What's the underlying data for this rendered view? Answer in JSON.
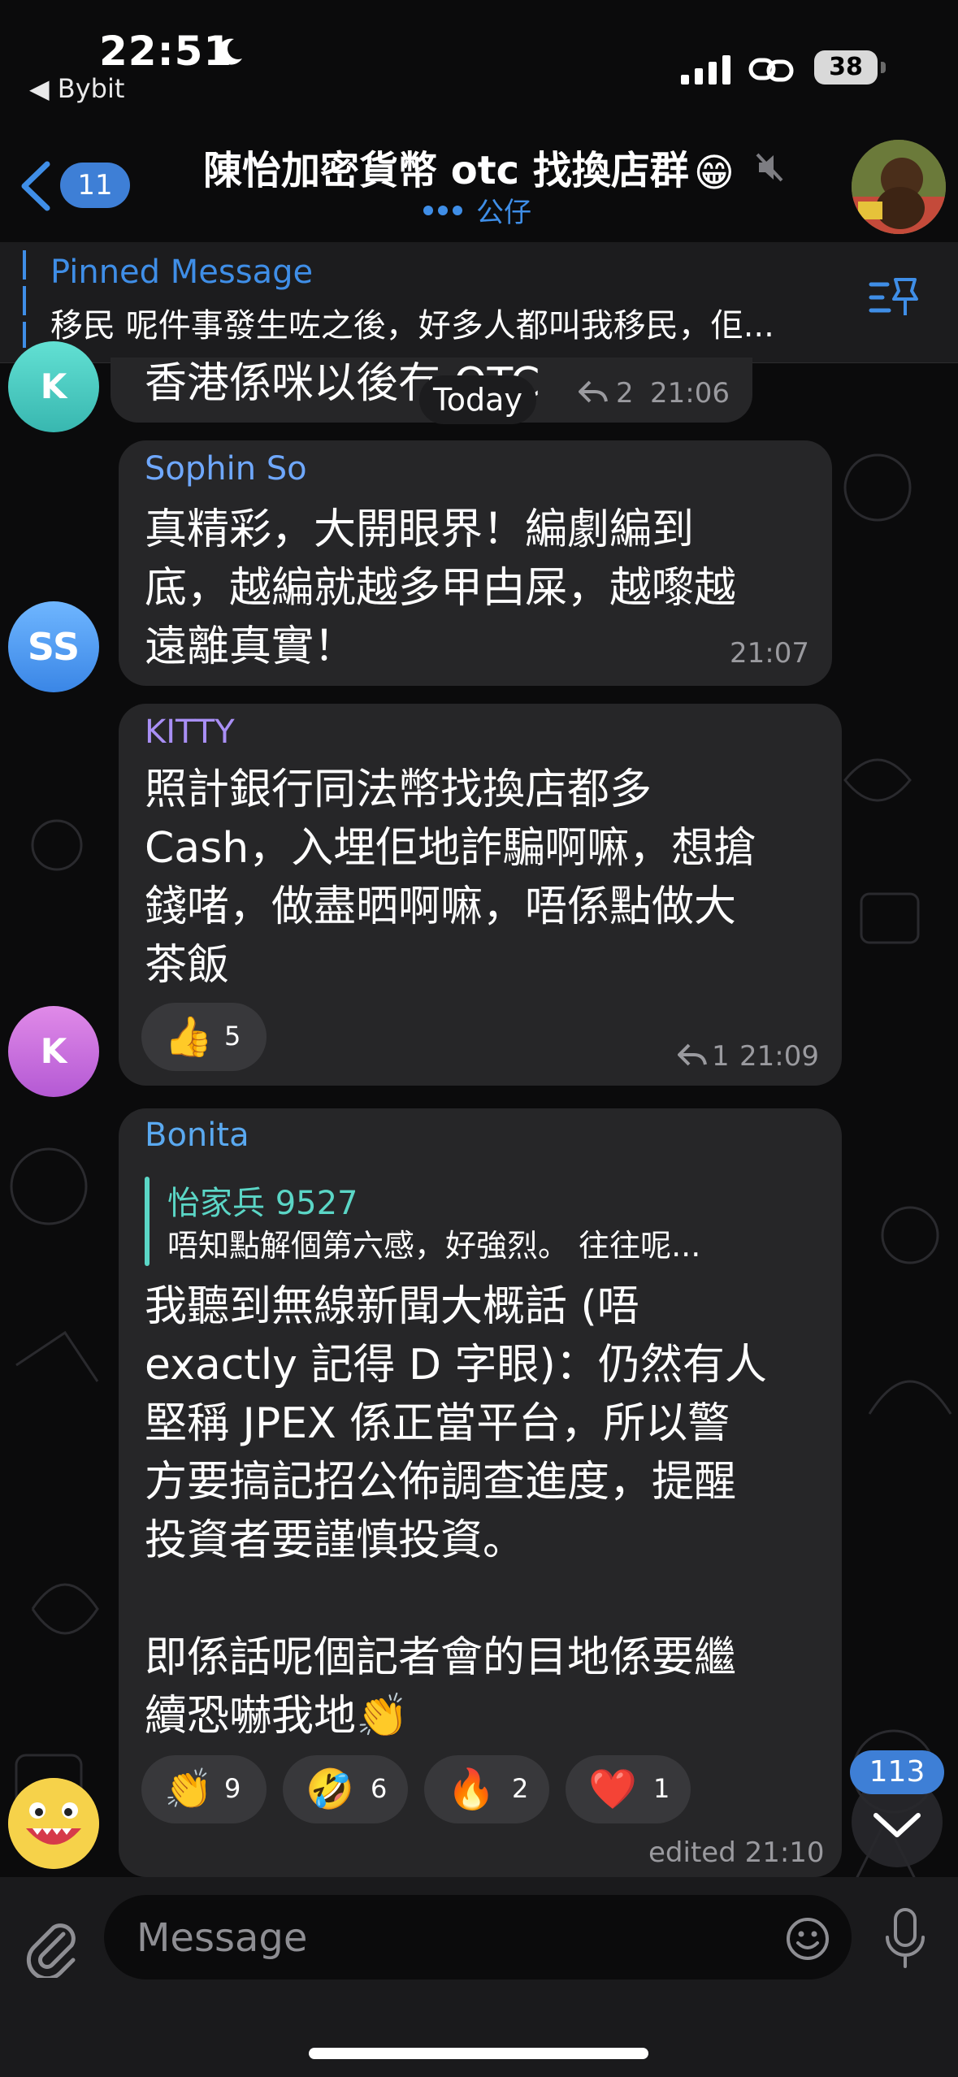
{
  "status_bar": {
    "time": "22:51",
    "back_app": "◀ Bybit",
    "battery": "38"
  },
  "header": {
    "back_badge": "11",
    "title": "陳怡加密貨幣 otc 找換店群",
    "title_emoji": "😁",
    "typing_user": "公仔"
  },
  "pinned": {
    "label": "Pinned Message",
    "text": "移民 呢件事發生咗之後，好多人都叫我移民，佢..."
  },
  "date_chip": "Today",
  "messages": [
    {
      "avatar_initials": "K",
      "text": "香港係咪以後冇 OTC",
      "replies": "2",
      "time": "21:06"
    },
    {
      "avatar_initials": "SS",
      "sender": "Sophin So",
      "sender_color": "#6fa8ff",
      "lines": [
        "真精彩，大開眼界！編劇編到",
        "底，越編就越多甲甴屎，越嚟越",
        "遠離真實！"
      ],
      "time": "21:07"
    },
    {
      "avatar_initials": "K",
      "sender": "KITTY",
      "sender_color": "#a98ff5",
      "lines": [
        "照計銀行同法幣找換店都多",
        "Cash，入埋佢地詐騙啊嘛，想搶",
        "錢啫，做盡晒啊嘛，唔係點做大",
        "茶飯"
      ],
      "reactions": [
        {
          "emoji": "👍",
          "count": "5"
        }
      ],
      "replies": "1",
      "time": "21:09"
    },
    {
      "sender": "Bonita",
      "sender_color": "#5aa9f0",
      "quote_name": "怡家兵 9527",
      "quote_text": "唔知點解個第六感，好強烈。 往往呢...",
      "lines": [
        "我聽到無線新聞大概話 (唔",
        "exactly 記得 D 字眼)：仍然有人",
        "堅稱 JPEX 係正當平台，所以警",
        "方要搞記招公佈調查進度，提醒",
        "投資者要謹慎投資。",
        "",
        "即係話呢個記者會的目地係要繼",
        "續恐嚇我地👏"
      ],
      "reactions": [
        {
          "emoji": "👏",
          "count": "9"
        },
        {
          "emoji": "🤣",
          "count": "6"
        },
        {
          "emoji": "🔥",
          "count": "2"
        },
        {
          "emoji": "❤️",
          "count": "1"
        }
      ],
      "time": "edited 21:10"
    }
  ],
  "scroll_badge": "113",
  "composer": {
    "placeholder": "Message"
  }
}
